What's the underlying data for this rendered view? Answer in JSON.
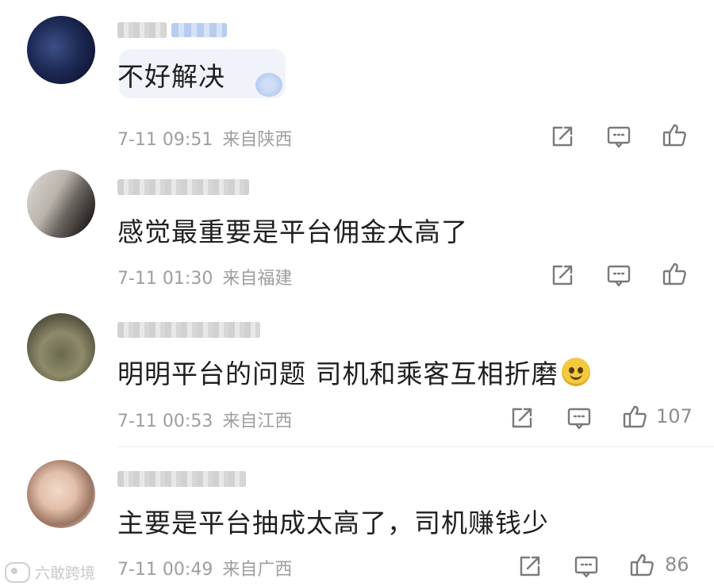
{
  "comments": [
    {
      "text": "不好解决",
      "time": "7-11 09:51",
      "location": "来自陕西",
      "likes": ""
    },
    {
      "text": "感觉最重要是平台佣金太高了",
      "time": "7-11 01:30",
      "location": "来自福建",
      "likes": ""
    },
    {
      "text": "明明平台的问题 司机和乘客互相折磨",
      "time": "7-11 00:53",
      "location": "来自江西",
      "likes": "107"
    },
    {
      "text": "主要是平台抽成太高了，司机赚钱少",
      "time": "7-11 00:49",
      "location": "来自广西",
      "likes": "86"
    }
  ],
  "icons": {
    "share": "share-icon",
    "reply": "comment-icon",
    "like": "thumbs-up-icon"
  },
  "watermark": {
    "text": "六敢跨境"
  },
  "colors": {
    "text": "#1f1f1f",
    "meta": "#9e9e9e",
    "icon": "#7a7a7a"
  }
}
